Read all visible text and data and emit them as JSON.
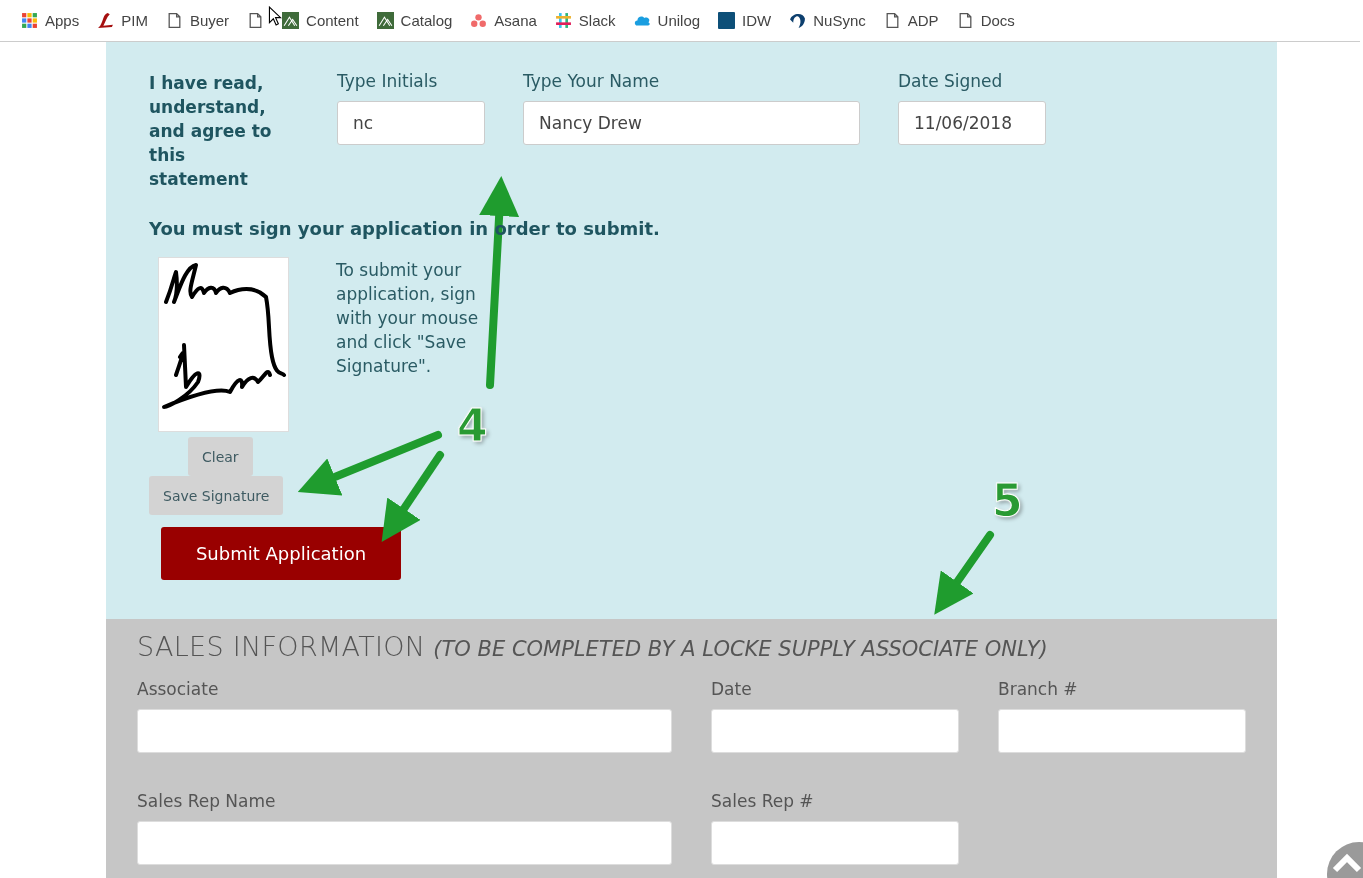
{
  "bookmarks": [
    {
      "kind": "grid",
      "label": "Apps"
    },
    {
      "kind": "pim",
      "label": "PIM"
    },
    {
      "kind": "page",
      "label": "Buyer"
    },
    {
      "kind": "page"
    },
    {
      "kind": "mountain",
      "label": "Content"
    },
    {
      "kind": "mountain",
      "label": "Catalog"
    },
    {
      "kind": "asana",
      "label": "Asana"
    },
    {
      "kind": "slack",
      "label": "Slack"
    },
    {
      "kind": "cloud",
      "label": "Unilog"
    },
    {
      "kind": "square",
      "label": "IDW"
    },
    {
      "kind": "nusync",
      "label": "NuSync"
    },
    {
      "kind": "page",
      "label": "ADP"
    },
    {
      "kind": "page",
      "label": "Docs"
    }
  ],
  "agreement": {
    "statement": "I have read, understand, and agree to this statement",
    "fields": [
      {
        "label": "Type Initials",
        "value": "nc"
      },
      {
        "label": "Type Your Name",
        "value": "Nancy Drew"
      },
      {
        "label": "Date Signed",
        "value": "11/06/2018"
      }
    ],
    "notice": "You must sign your application in order to submit.",
    "instructions": "To submit your application, sign with your mouse and click \"Save Signature\".",
    "clear_button": "Clear",
    "save_button": "Save Signature",
    "submit_button": "Submit Application"
  },
  "sales": {
    "title": "SALES INFORMATION",
    "subtitle": "(TO BE COMPLETED BY A LOCKE SUPPLY ASSOCIATE ONLY)",
    "rows": [
      [
        {
          "label": "Associate"
        },
        {
          "label": "Date"
        },
        {
          "label": "Branch #"
        }
      ],
      [
        {
          "label": "Sales Rep Name"
        },
        {
          "label": "Sales Rep #"
        }
      ]
    ]
  },
  "annotations": [
    {
      "number": "4"
    },
    {
      "number": "5"
    }
  ]
}
